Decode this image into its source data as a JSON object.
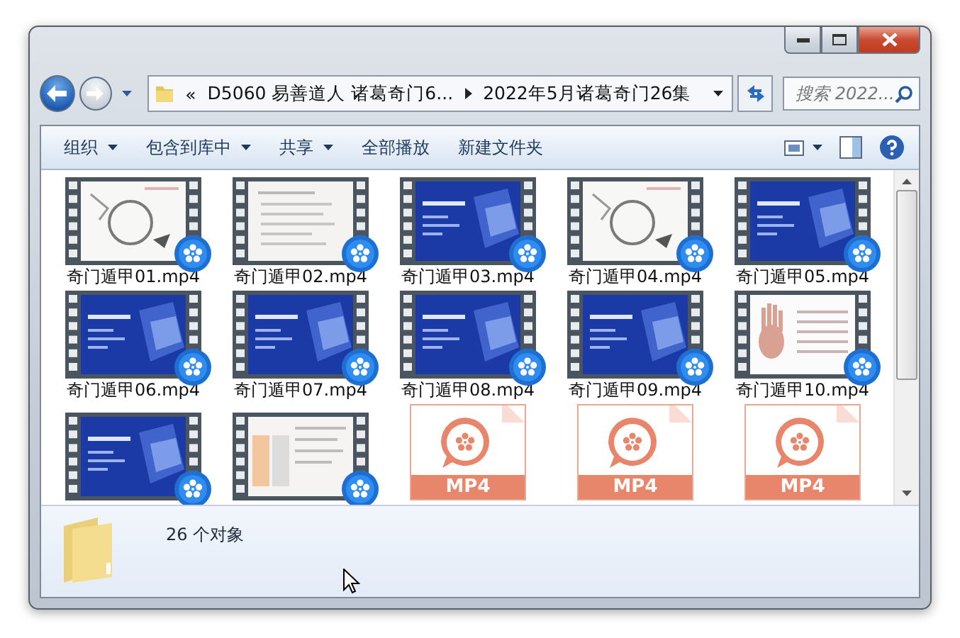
{
  "address": {
    "overflow_mark": "«",
    "path": [
      {
        "label": "D5060 易善道人 诸葛奇门6..."
      },
      {
        "label": "2022年5月诸葛奇门26集"
      }
    ]
  },
  "search": {
    "placeholder": "搜索 2022..."
  },
  "toolbar": {
    "items": [
      {
        "label": "组织",
        "dropdown": true
      },
      {
        "label": "包含到库中",
        "dropdown": true
      },
      {
        "label": "共享",
        "dropdown": true
      },
      {
        "label": "全部播放",
        "dropdown": false
      },
      {
        "label": "新建文件夹",
        "dropdown": false
      }
    ]
  },
  "files": [
    {
      "name": "奇门遁甲01.mp4",
      "kind": "ink"
    },
    {
      "name": "奇门遁甲02.mp4",
      "kind": "notes"
    },
    {
      "name": "奇门遁甲03.mp4",
      "kind": "slide"
    },
    {
      "name": "奇门遁甲04.mp4",
      "kind": "ink"
    },
    {
      "name": "奇门遁甲05.mp4",
      "kind": "slide"
    },
    {
      "name": "奇门遁甲06.mp4",
      "kind": "slide"
    },
    {
      "name": "奇门遁甲07.mp4",
      "kind": "slide"
    },
    {
      "name": "奇门遁甲08.mp4",
      "kind": "slide"
    },
    {
      "name": "奇门遁甲09.mp4",
      "kind": "slide"
    },
    {
      "name": "奇门遁甲10.mp4",
      "kind": "palm"
    },
    {
      "kind": "slide"
    },
    {
      "kind": "table"
    },
    {
      "kind": "document",
      "badge": "MP4"
    },
    {
      "kind": "document",
      "badge": "MP4"
    },
    {
      "kind": "document",
      "badge": "MP4"
    }
  ],
  "status": {
    "count": "26 个对象"
  }
}
